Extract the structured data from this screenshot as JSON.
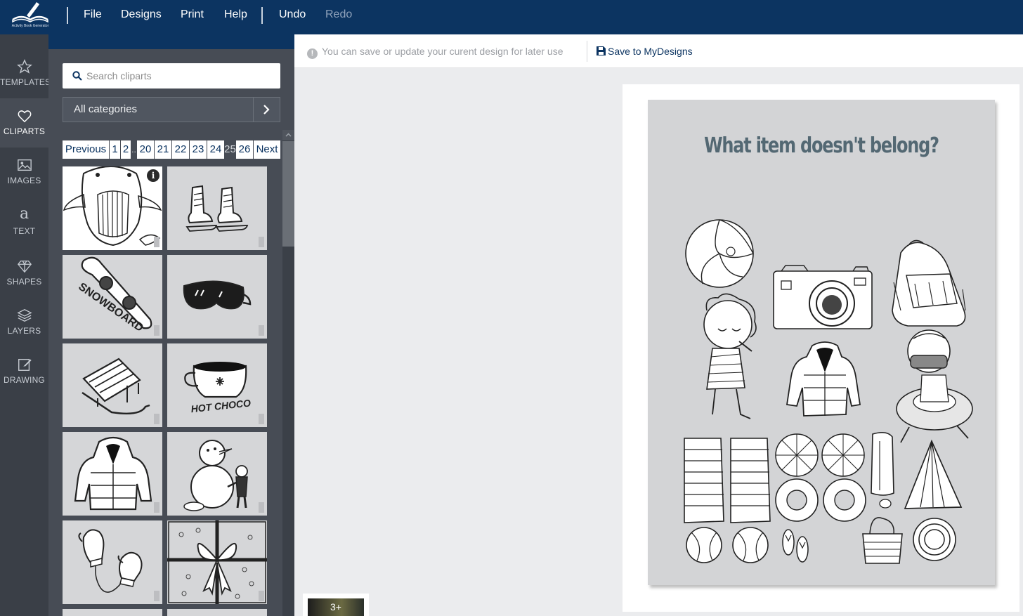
{
  "app": {
    "logo_text": "Activity Book Generator",
    "menu": [
      "File",
      "Designs",
      "Print",
      "Help"
    ],
    "undo": "Undo",
    "redo": "Redo"
  },
  "rail": [
    {
      "label": "TEMPLATES",
      "icon": "star-icon"
    },
    {
      "label": "CLIPARTS",
      "icon": "heart-icon",
      "active": true
    },
    {
      "label": "IMAGES",
      "icon": "image-icon"
    },
    {
      "label": "TEXT",
      "icon": "text-icon"
    },
    {
      "label": "SHAPES",
      "icon": "diamond-icon"
    },
    {
      "label": "LAYERS",
      "icon": "layers-icon"
    },
    {
      "label": "DRAWING",
      "icon": "edit-icon"
    }
  ],
  "cliparts": {
    "search_placeholder": "Search cliparts",
    "category": "All categories",
    "pager": [
      "Previous",
      "1",
      "2",
      "..",
      "20",
      "21",
      "22",
      "23",
      "24",
      "25",
      "26",
      "Next"
    ],
    "current_page": "25",
    "tiles": [
      {
        "name": "whale",
        "label": ""
      },
      {
        "name": "ice-skates",
        "label": ""
      },
      {
        "name": "snowboard",
        "label": "SNOWBOARD"
      },
      {
        "name": "ski-goggles",
        "label": ""
      },
      {
        "name": "sled",
        "label": ""
      },
      {
        "name": "hot-chocolate",
        "label": "HOT CHOCO"
      },
      {
        "name": "puffer-jacket",
        "label": ""
      },
      {
        "name": "snowman",
        "label": ""
      },
      {
        "name": "mittens",
        "label": ""
      },
      {
        "name": "gift-box",
        "label": ""
      }
    ]
  },
  "savebar": {
    "hint": "You can save or update your curent design for later use",
    "save_label": "Save to MyDesigns"
  },
  "design": {
    "title": "What item doesn't belong?"
  },
  "badge": "3+",
  "colors": {
    "topbar": "#0c3461",
    "rail": "#3a3f47",
    "panel": "#474c55",
    "title": "#536873"
  }
}
